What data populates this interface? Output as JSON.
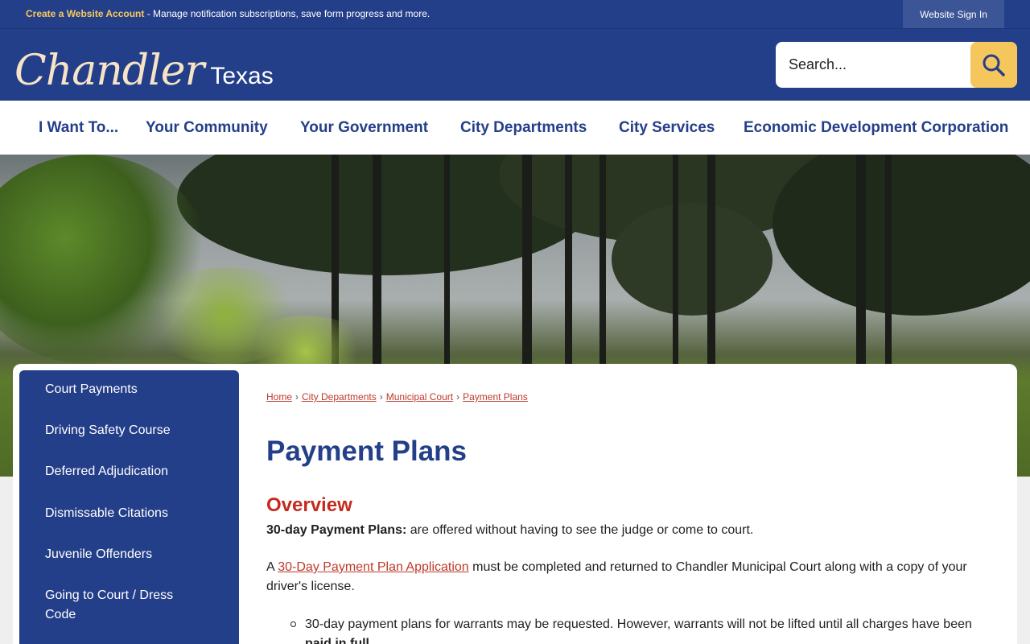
{
  "topbar": {
    "create_link": "Create a Website Account",
    "notice_text": " - Manage notification subscriptions, save form progress and more.",
    "signin_label": "Website Sign In"
  },
  "header": {
    "logo_script": "Chandler",
    "logo_state": "Texas",
    "search_placeholder": "Search...",
    "search_icon": "search-icon"
  },
  "nav": {
    "items": [
      {
        "label": "I Want To..."
      },
      {
        "label": "Your Community"
      },
      {
        "label": "Your Government"
      },
      {
        "label": "City Departments"
      },
      {
        "label": "City Services"
      },
      {
        "label": "Economic Development Corporation"
      }
    ]
  },
  "sidebar": {
    "items": [
      {
        "label": "Court Payments"
      },
      {
        "label": "Driving Safety Course"
      },
      {
        "label": "Deferred Adjudication"
      },
      {
        "label": "Dismissable Citations"
      },
      {
        "label": "Juvenile Offenders"
      },
      {
        "label": "Going to Court / Dress Code"
      }
    ]
  },
  "breadcrumb": {
    "items": [
      {
        "label": "Home"
      },
      {
        "label": "City Departments"
      },
      {
        "label": "Municipal Court"
      },
      {
        "label": "Payment Plans"
      }
    ],
    "separator": "›"
  },
  "main": {
    "title": "Payment Plans",
    "subhead": "Overview",
    "para1_bold": "30-day Payment Plans:",
    "para1_rest": " are offered without having to see the judge or come to court.",
    "para2_prefix": "A ",
    "para2_link": "30-Day Payment Plan Application",
    "para2_rest": " must be completed and returned to Chandler Municipal Court along with a copy of your driver's license.",
    "bullet_text": "30-day payment plans for warrants may be requested.  However, warrants will not be lifted until all charges have been ",
    "bullet_bold": "paid in full",
    "bullet_end": "."
  },
  "colors": {
    "brand_blue": "#243f89",
    "accent_gold": "#f5c65b",
    "link_red": "#c0392b",
    "heading_red": "#c62a1f"
  }
}
